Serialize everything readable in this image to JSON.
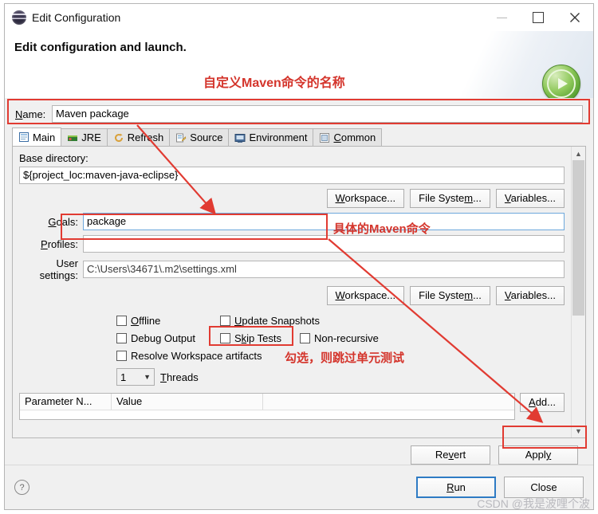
{
  "window": {
    "title": "Edit Configuration",
    "icon": "eclipse-icon",
    "minimize": "–",
    "maximize": "□",
    "close": "✕"
  },
  "header": {
    "title": "Edit configuration and launch.",
    "run_badge_icon": "run-play-icon"
  },
  "name_field": {
    "label": "Name:",
    "value": "Maven package",
    "placeholder": ""
  },
  "tabs": [
    {
      "label": "Main",
      "icon": "main-tab-icon",
      "active": true
    },
    {
      "label": "JRE",
      "icon": "jre-tab-icon",
      "active": false
    },
    {
      "label": "Refresh",
      "icon": "refresh-tab-icon",
      "active": false
    },
    {
      "label": "Source",
      "icon": "source-tab-icon",
      "active": false
    },
    {
      "label": "Environment",
      "icon": "environment-tab-icon",
      "active": false
    },
    {
      "label": "Common",
      "icon": "common-tab-icon",
      "active": false
    }
  ],
  "main_tab": {
    "base_directory": {
      "label": "Base directory:",
      "value": "${project_loc:maven-java-eclipse}"
    },
    "base_buttons": {
      "workspace": "Workspace...",
      "file_system": "File System...",
      "variables": "Variables..."
    },
    "goals": {
      "label": "Goals:",
      "value": "package"
    },
    "profiles": {
      "label": "Profiles:",
      "value": ""
    },
    "user_settings": {
      "label": "User settings:",
      "value": "C:\\Users\\34671\\.m2\\settings.xml"
    },
    "settings_buttons": {
      "workspace": "Workspace...",
      "file_system": "File System...",
      "variables": "Variables..."
    },
    "checkboxes": [
      {
        "label": "Offline",
        "checked": false
      },
      {
        "label": "Update Snapshots",
        "checked": false
      },
      {
        "label": "Debug Output",
        "checked": false
      },
      {
        "label": "Skip Tests",
        "checked": false
      },
      {
        "label": "Non-recursive",
        "checked": false
      },
      {
        "label": "Resolve Workspace artifacts",
        "checked": false
      }
    ],
    "threads": {
      "value": "1",
      "label": "Threads"
    },
    "parameter_table": {
      "columns": [
        "Parameter N...",
        "Value",
        ""
      ],
      "rows": []
    },
    "table_buttons": {
      "add": "Add..."
    }
  },
  "apply_row": {
    "revert": "Revert",
    "apply": "Apply"
  },
  "footer": {
    "help_icon": "help-icon",
    "run": "Run",
    "close": "Close"
  },
  "annotations": [
    {
      "id": "name",
      "text": "自定义Maven命令的名称"
    },
    {
      "id": "goals",
      "text": "具体的Maven命令"
    },
    {
      "id": "skip",
      "text": "勾选，则跳过单元测试"
    }
  ],
  "watermark": "CSDN @我是波哩个波",
  "colors": {
    "annotation_red": "#d4352c",
    "box_red": "#e13b32",
    "default_button_blue": "#2e7bc4",
    "run_badge_green": "#57a032"
  }
}
